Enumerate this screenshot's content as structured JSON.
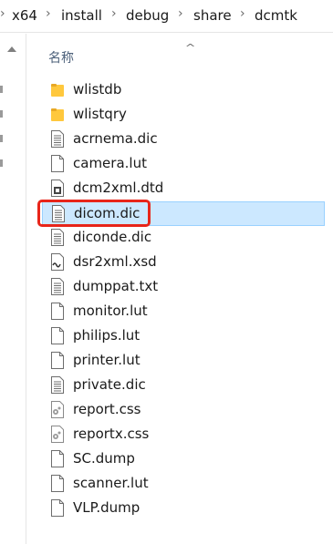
{
  "breadcrumb": [
    "x64",
    "install",
    "debug",
    "share",
    "dcmtk"
  ],
  "column_header": "名称",
  "files": [
    {
      "name": "wlistdb",
      "icon": "folder-icon"
    },
    {
      "name": "wlistqry",
      "icon": "folder-icon"
    },
    {
      "name": "acrnema.dic",
      "icon": "text-file-icon"
    },
    {
      "name": "camera.lut",
      "icon": "blank-file-icon"
    },
    {
      "name": "dcm2xml.dtd",
      "icon": "dtd-file-icon"
    },
    {
      "name": "dicom.dic",
      "icon": "text-file-icon",
      "selected": true
    },
    {
      "name": "diconde.dic",
      "icon": "text-file-icon"
    },
    {
      "name": "dsr2xml.xsd",
      "icon": "xsd-file-icon"
    },
    {
      "name": "dumppat.txt",
      "icon": "text-file-icon"
    },
    {
      "name": "monitor.lut",
      "icon": "blank-file-icon"
    },
    {
      "name": "philips.lut",
      "icon": "blank-file-icon"
    },
    {
      "name": "printer.lut",
      "icon": "blank-file-icon"
    },
    {
      "name": "private.dic",
      "icon": "text-file-icon"
    },
    {
      "name": "report.css",
      "icon": "css-file-icon"
    },
    {
      "name": "reportx.css",
      "icon": "css-file-icon"
    },
    {
      "name": "SC.dump",
      "icon": "blank-file-icon"
    },
    {
      "name": "scanner.lut",
      "icon": "blank-file-icon"
    },
    {
      "name": "VLP.dump",
      "icon": "blank-file-icon"
    }
  ],
  "colors": {
    "selection_bg": "#cce8ff",
    "selection_border": "#99d1ff",
    "annotation_red": "#e8251a",
    "folder_yellow": "#ffc83d"
  }
}
